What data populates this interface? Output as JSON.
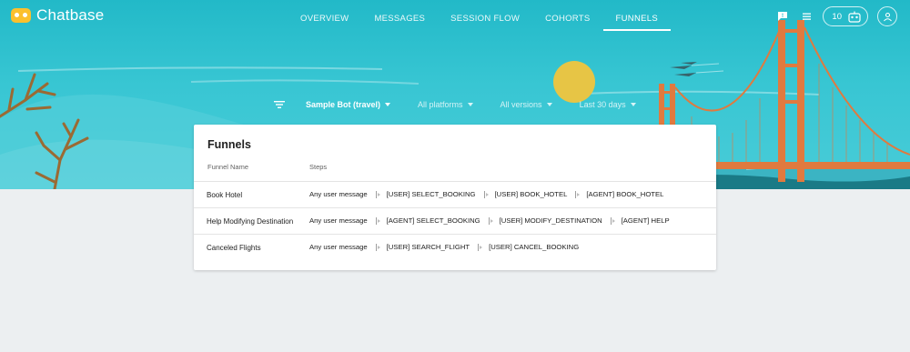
{
  "app": {
    "name": "Chatbase"
  },
  "colors": {
    "sky": "#38c6d3",
    "bridge": "#e07a3f",
    "sun": "#e7c545",
    "accent_logo": "#fbc02d"
  },
  "nav": {
    "tabs": [
      {
        "label": "OVERVIEW",
        "active": false
      },
      {
        "label": "MESSAGES",
        "active": false
      },
      {
        "label": "SESSION FLOW",
        "active": false
      },
      {
        "label": "COHORTS",
        "active": false
      },
      {
        "label": "FUNNELS",
        "active": true
      }
    ]
  },
  "header": {
    "feedback_icon": "feedback-icon",
    "docs_icon": "docs-icon",
    "credits_count": "10",
    "bot_icon": "bot-icon",
    "account_icon": "account-icon"
  },
  "filters": {
    "icon": "filter-icon",
    "bot": "Sample Bot (travel)",
    "platforms": "All platforms",
    "versions": "All versions",
    "range": "Last 30 days"
  },
  "funnels": {
    "title": "Funnels",
    "columns": {
      "name": "Funnel Name",
      "steps": "Steps"
    },
    "rows": [
      {
        "name": "Book Hotel",
        "steps": [
          "Any user message",
          "[USER] SELECT_BOOKING",
          "[USER] BOOK_HOTEL",
          "[AGENT] BOOK_HOTEL"
        ]
      },
      {
        "name": "Help Modifying Destination",
        "steps": [
          "Any user message",
          "[AGENT] SELECT_BOOKING",
          "[USER] MODIFY_DESTINATION",
          "[AGENT] HELP"
        ]
      },
      {
        "name": "Canceled Flights",
        "steps": [
          "Any user message",
          "[USER] SEARCH_FLIGHT",
          "[USER] CANCEL_BOOKING"
        ]
      }
    ]
  }
}
